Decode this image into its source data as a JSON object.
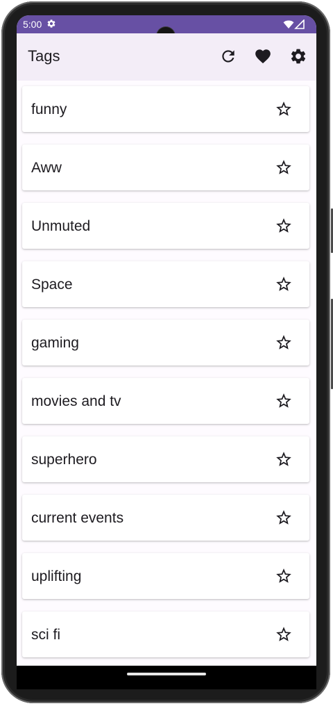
{
  "status_bar": {
    "time": "5:00",
    "settings_icon": "gear-icon",
    "wifi_icon": "wifi-icon",
    "signal_icon": "cell-signal-icon",
    "color": "#6750a4"
  },
  "app_bar": {
    "title": "Tags",
    "actions": [
      {
        "name": "refresh",
        "icon": "refresh-icon"
      },
      {
        "name": "favorites",
        "icon": "heart-icon"
      },
      {
        "name": "settings",
        "icon": "gear-icon"
      }
    ],
    "background": "#f3edf7"
  },
  "tags": [
    {
      "label": "funny",
      "favorite": false
    },
    {
      "label": "Aww",
      "favorite": false
    },
    {
      "label": "Unmuted",
      "favorite": false
    },
    {
      "label": "Space",
      "favorite": false
    },
    {
      "label": "gaming",
      "favorite": false
    },
    {
      "label": "movies and tv",
      "favorite": false
    },
    {
      "label": "superhero",
      "favorite": false
    },
    {
      "label": "current events",
      "favorite": false
    },
    {
      "label": "uplifting",
      "favorite": false
    },
    {
      "label": "sci fi",
      "favorite": false
    }
  ]
}
